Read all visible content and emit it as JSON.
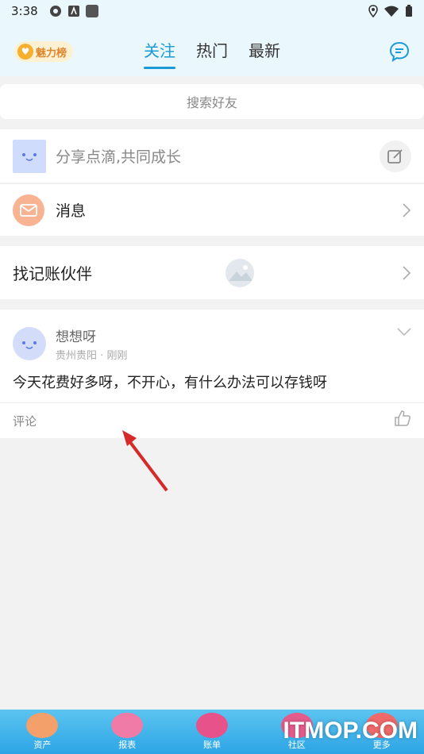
{
  "status_bar": {
    "time": "3:38"
  },
  "header": {
    "charm_label": "魅力榜",
    "tabs": [
      {
        "label": "关注",
        "active": true
      },
      {
        "label": "热门",
        "active": false
      },
      {
        "label": "最新",
        "active": false
      }
    ]
  },
  "search": {
    "placeholder": "搜索好友"
  },
  "post": {
    "placeholder": "分享点滴,共同成长"
  },
  "messages": {
    "label": "消息"
  },
  "partner": {
    "label": "找记账伙伴"
  },
  "feed": {
    "name": "想想呀",
    "location": "贵州贵阳",
    "separator": "·",
    "time": "刚刚",
    "text": "今天花费好多呀，不开心，有什么办法可以存钱呀",
    "comment_label": "评论"
  },
  "bottom_nav": [
    {
      "label": "资产"
    },
    {
      "label": "报表"
    },
    {
      "label": "账单"
    },
    {
      "label": "社区"
    },
    {
      "label": "更多"
    }
  ],
  "watermark": "ITMOP.COM",
  "colors": {
    "accent": "#1a9bd6",
    "page_bg": "#f2f2f2",
    "header_bg": "#eaf7fc",
    "bottom_bar": "#2da5e6"
  }
}
